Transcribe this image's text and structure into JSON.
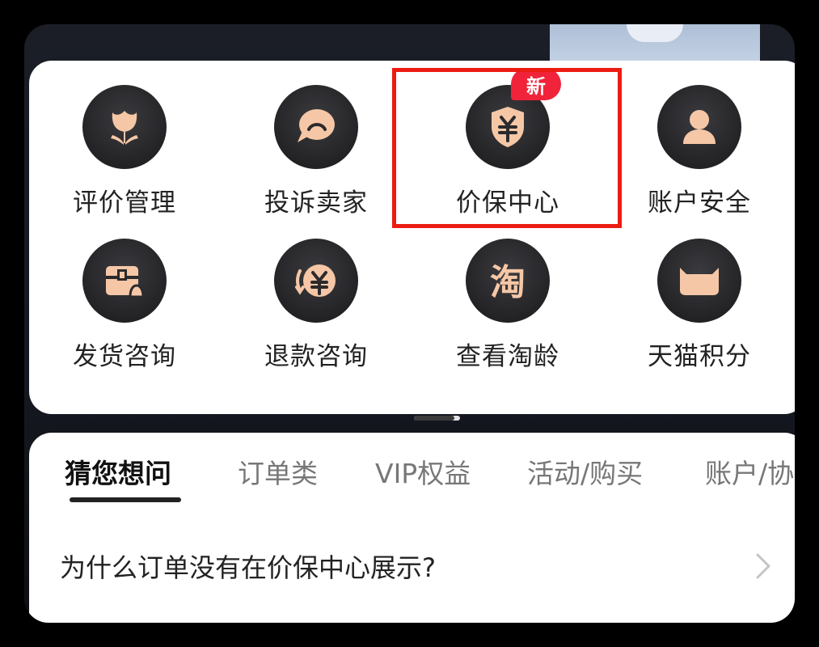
{
  "services": {
    "items": [
      {
        "label": "评价管理",
        "icon": "tulip-icon"
      },
      {
        "label": "投诉卖家",
        "icon": "complaint-chat-icon"
      },
      {
        "label": "价保中心",
        "icon": "yuan-shield-icon",
        "badge": "新",
        "highlighted": true
      },
      {
        "label": "账户安全",
        "icon": "user-icon"
      },
      {
        "label": "发货咨询",
        "icon": "package-bell-icon"
      },
      {
        "label": "退款咨询",
        "icon": "refund-yuan-icon"
      },
      {
        "label": "查看淘龄",
        "icon": "tao-character-icon"
      },
      {
        "label": "天猫积分",
        "icon": "tmall-cat-icon"
      }
    ]
  },
  "faq": {
    "tabs": [
      "猜您想问",
      "订单类",
      "VIP权益",
      "活动/购买",
      "账户/协"
    ],
    "active_tab": "猜您想问",
    "question": "为什么订单没有在价保中心展示?"
  },
  "colors": {
    "icon_peach": "#f6c7a6",
    "badge_red": "#f0233a",
    "highlight_red": "#ec1c12"
  }
}
